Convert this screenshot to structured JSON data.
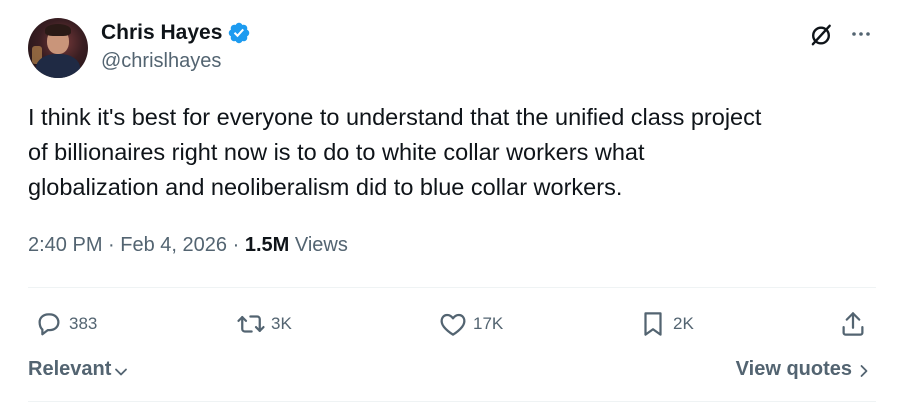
{
  "author": {
    "name": "Chris Hayes",
    "handle": "@chrislhayes",
    "verified": true
  },
  "tweet": {
    "text_lines": [
      "I think it's best for everyone to understand that the unified class project",
      "of billionaires right now is to do to white collar workers what",
      "globalization and neoliberalism did to blue collar workers."
    ],
    "time": "2:40 PM",
    "separator": "·",
    "date": "Feb 4, 2026",
    "views_count": "1.5M",
    "views_label": "Views"
  },
  "actions": {
    "replies": "383",
    "reposts": "3K",
    "likes": "17K",
    "bookmarks": "2K"
  },
  "footer": {
    "sort_label": "Relevant",
    "quotes_label": "View quotes"
  },
  "colors": {
    "text_primary": "#0f1419",
    "text_secondary": "#536471",
    "verified_blue": "#1d9bf0",
    "divider": "#eff3f4"
  },
  "icons": [
    "grok-icon",
    "more-icon",
    "reply-icon",
    "repost-icon",
    "like-icon",
    "bookmark-icon",
    "share-icon",
    "chevron-down-icon",
    "chevron-right-icon",
    "verified-badge-icon"
  ]
}
